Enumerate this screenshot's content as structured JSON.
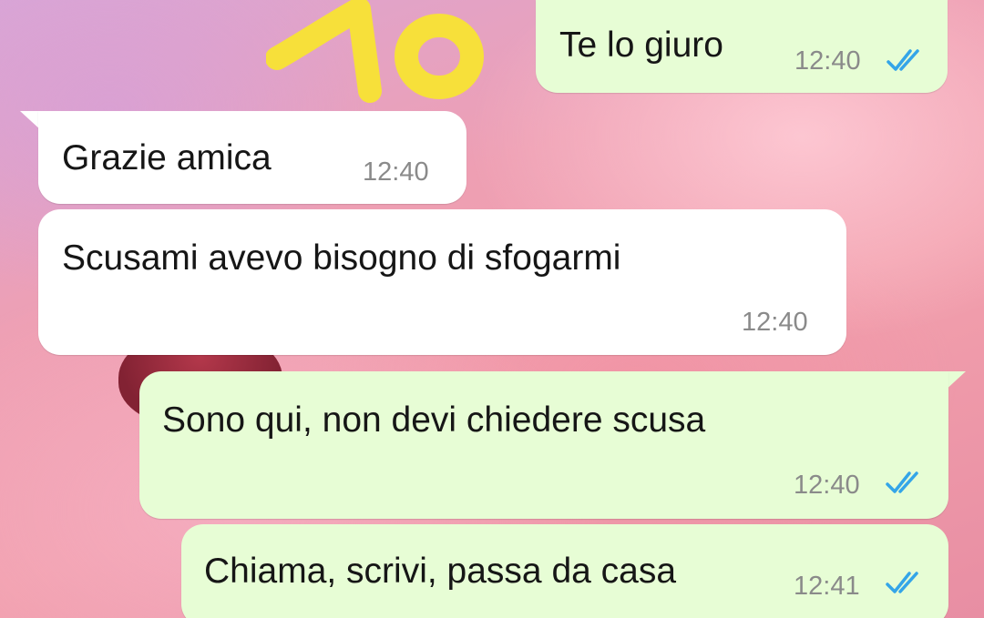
{
  "annotation": {
    "text": "10",
    "color": "#f7e03a"
  },
  "colors": {
    "incoming_bubble": "#ffffff",
    "outgoing_bubble": "#e7fdd5",
    "read_ticks": "#34a5e8",
    "timestamp": "#8a8a8a"
  },
  "messages": [
    {
      "direction": "outgoing",
      "text": "Te lo giuro",
      "time": "12:40",
      "status": "read",
      "status_icon": "double-check-icon"
    },
    {
      "direction": "incoming",
      "text": "Grazie amica",
      "time": "12:40"
    },
    {
      "direction": "incoming",
      "text": "Scusami avevo bisogno di sfogarmi",
      "time": "12:40"
    },
    {
      "direction": "outgoing",
      "text": "Sono qui, non devi chiedere scusa",
      "time": "12:40",
      "status": "read",
      "status_icon": "double-check-icon"
    },
    {
      "direction": "outgoing",
      "text": "Chiama, scrivi, passa da casa",
      "time": "12:41",
      "status": "read",
      "status_icon": "double-check-icon"
    }
  ]
}
